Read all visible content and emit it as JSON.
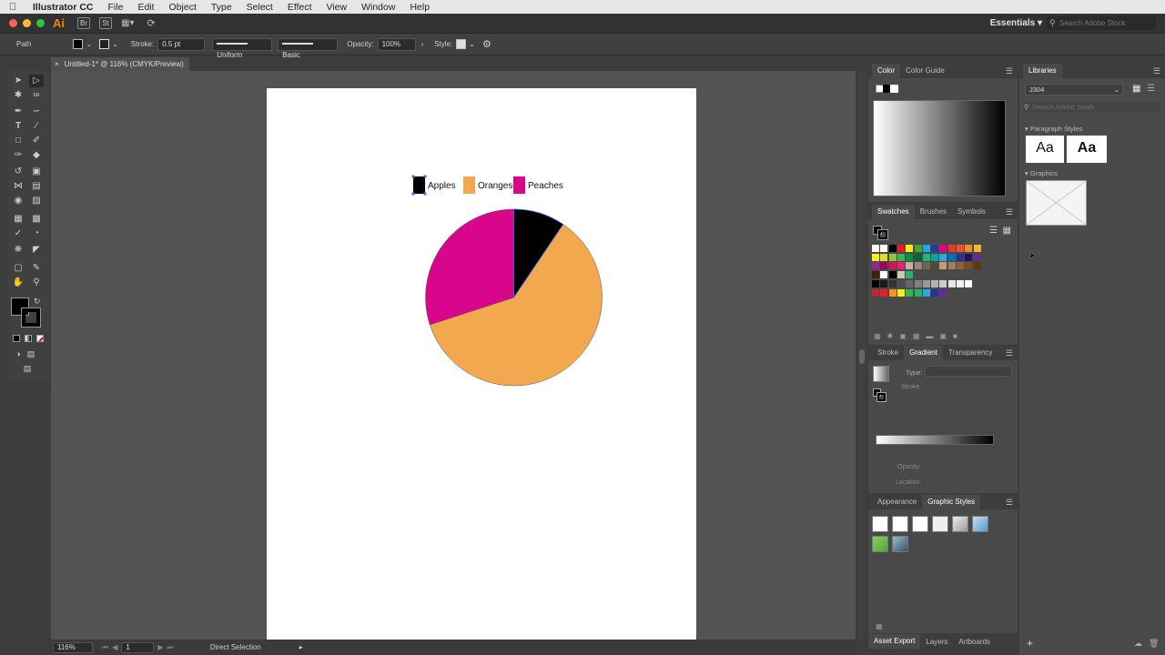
{
  "menubar": {
    "app_name": "Illustrator CC",
    "items": [
      "File",
      "Edit",
      "Object",
      "Type",
      "Select",
      "Effect",
      "View",
      "Window",
      "Help"
    ]
  },
  "appbar": {
    "logo": "Ai",
    "bridge_label": "Br",
    "stock_label": "St",
    "workspace": "Essentials",
    "search_placeholder": "Search Adobe Stock"
  },
  "controlbar": {
    "selection_type": "Path",
    "stroke_label": "Stroke:",
    "stroke_weight": "0.5 pt",
    "profile": "Uniform",
    "brush": "Basic",
    "opacity_label": "Opacity:",
    "opacity_value": "100%",
    "style_label": "Style:"
  },
  "document": {
    "tab_title": "Untitled-1* @ 116% (CMYK/Preview)"
  },
  "statusbar": {
    "zoom": "116%",
    "artboard_number": "1",
    "tool_name": "Direct Selection"
  },
  "chart_data": {
    "type": "pie",
    "legend": [
      "Apples",
      "Oranges",
      "Peaches"
    ],
    "legend_placement": "top",
    "colors": [
      "#000000",
      "#f2a84e",
      "#d7068a"
    ]
  },
  "color_panel": {
    "tabs": [
      "Color",
      "Color Guide"
    ]
  },
  "swatches_panel": {
    "tabs": [
      "Swatches",
      "Brushes",
      "Symbols"
    ]
  },
  "gradient_panel": {
    "tabs": [
      "Stroke",
      "Gradient",
      "Transparency"
    ],
    "type_label": "Type:",
    "stroke_label": "Stroke:",
    "opacity_label": "Opacity:",
    "location_label": "Location:"
  },
  "graphic_styles_panel": {
    "tabs": [
      "Appearance",
      "Graphic Styles"
    ]
  },
  "bottom_tabs": [
    "Asset Export",
    "Layers",
    "Artboards"
  ],
  "libraries": {
    "title": "Libraries",
    "library_name": "J304",
    "search_placeholder": "Search Adobe Stock",
    "paragraph_styles_label": "Paragraph Styles",
    "style_sample_1": "Aa",
    "style_sample_2": "Aa",
    "graphics_label": "Graphics"
  }
}
